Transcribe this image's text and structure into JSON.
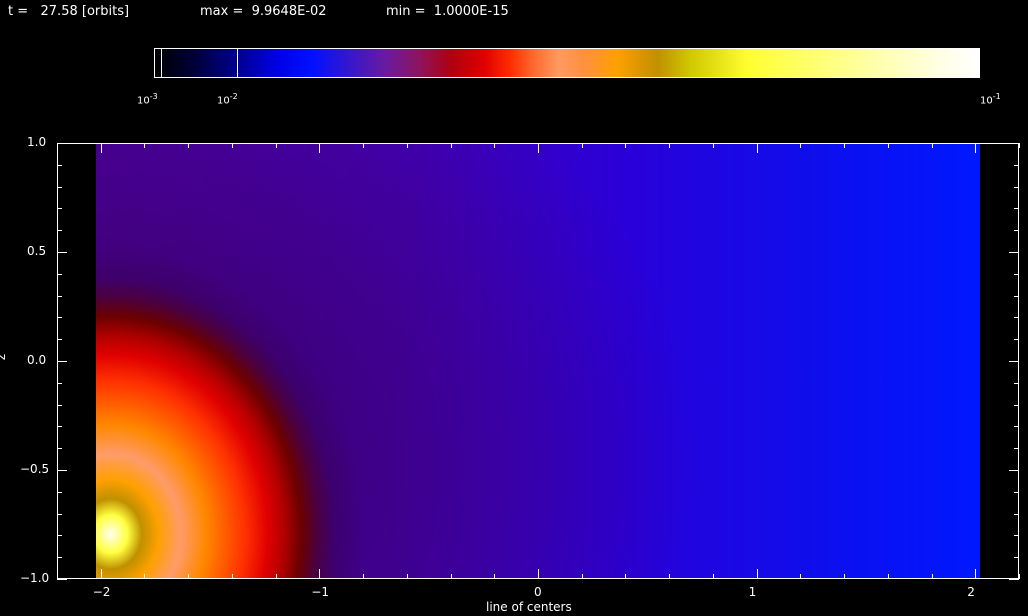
{
  "header": {
    "time": "t =   27.58 [orbits]",
    "max": "max =  9.9648E-02",
    "min": "min =  1.0000E-15"
  },
  "colorbar": {
    "ticks": [
      {
        "base": "10",
        "exp": "-3",
        "over": "10",
        "overexp": "+3"
      },
      {
        "base": "10",
        "exp": "-2"
      },
      {
        "base": "10",
        "exp": "-1"
      }
    ]
  },
  "plot": {
    "xlabel": "line of centers",
    "ylabel": "z",
    "xticks": [
      "−2",
      "−1",
      "0",
      "1",
      "2"
    ],
    "yticks": [
      "1.0",
      "0.5",
      "0.0",
      "−0.5",
      "−1.0"
    ],
    "xlim": [
      -2.2,
      2.2
    ],
    "ylim": [
      -1.0,
      1.0
    ],
    "colormap_accent": [
      "#000000",
      "#0000ff",
      "#e00000",
      "#ffa000",
      "#ffff30",
      "#ffffff"
    ]
  }
}
